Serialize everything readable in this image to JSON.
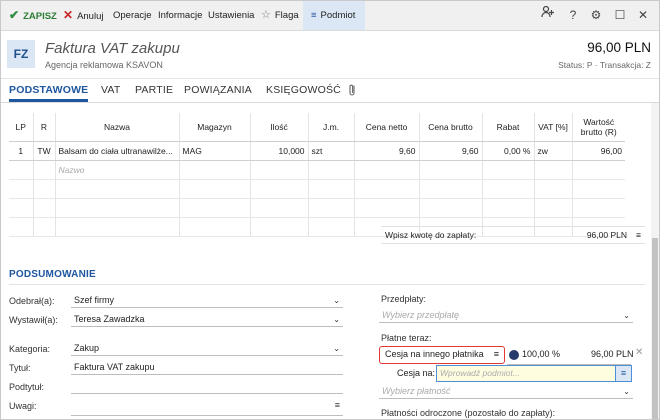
{
  "toolbar": {
    "save": "ZAPISZ",
    "cancel": "Anuluj",
    "operations": "Operacje",
    "info": "Informacje",
    "settings": "Ustawienia",
    "flag": "Flaga",
    "subject": "Podmiot"
  },
  "header": {
    "badge": "FZ",
    "title": "Faktura VAT zakupu",
    "subtitle": "Agencja reklamowa KSAVON",
    "amount": "96,00 PLN",
    "status": "Status: P  ·  Transakcja: Z"
  },
  "tabs": [
    "PODSTAWOWE",
    "VAT",
    "PARTIE",
    "POWIĄZANIA",
    "KSIĘGOWOŚĆ"
  ],
  "grid": {
    "columns": [
      "LP",
      "R",
      "Nazwa",
      "Magazyn",
      "Ilość",
      "J.m.",
      "Cena netto",
      "Cena brutto",
      "Rabat",
      "VAT [%]",
      "Wartość brutto (R)"
    ],
    "rows": [
      [
        "1",
        "TW",
        "Balsam do ciała ultranawilże...",
        "MAG",
        "10,000",
        "szt",
        "9,60",
        "9,60",
        "0,00 %",
        "zw",
        "96,00"
      ]
    ],
    "new_row_placeholder": "Nazwo"
  },
  "payment_line": {
    "label": "Wpisz kwotę do zapłaty:",
    "value": "96,00 PLN"
  },
  "summary": {
    "title": "PODSUMOWANIE",
    "odebral_label": "Odebrał(a):",
    "odebral_value": "Szef firmy",
    "wystawil_label": "Wystawił(a):",
    "wystawil_value": "Teresa Zawadzka",
    "kategoria_label": "Kategoria:",
    "kategoria_value": "Zakup",
    "tytul_label": "Tytuł:",
    "tytul_value": "Faktura VAT zakupu",
    "podtytul_label": "Podtytuł:",
    "uwagi_label": "Uwagi:"
  },
  "payments": {
    "przedplaty_label": "Przedpłaty:",
    "przedplaty_placeholder": "Wybierz przedpłatę",
    "platne_teraz_label": "Płatne teraz:",
    "cesja_value": "Cesja na innego płatnika",
    "percent": "100,00 %",
    "amount": "96,00 PLN",
    "cesja_na_label": "Cesja na:",
    "cesja_na_placeholder": "Wprowadź podmiot...",
    "platnosc_placeholder": "Wybierz płatność",
    "odroczone_label": "Płatności odroczone (pozostało do zapłaty):"
  }
}
